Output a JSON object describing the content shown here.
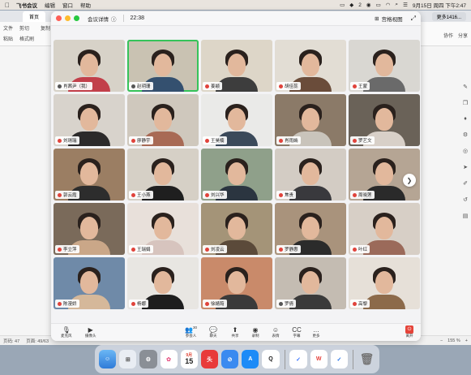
{
  "menubar": {
    "app_name": "飞书会议",
    "items": [
      "编辑",
      "窗口",
      "帮助"
    ],
    "datetime": "9月15日 周四 下午2:47",
    "badge_count": "2"
  },
  "background_window": {
    "tab_label": "首页",
    "second_tab": "更多1416...",
    "toolbar_items": [
      "文件",
      "粘贴",
      "剪切",
      "格式刷",
      "复制"
    ],
    "right_tools": [
      "协作",
      "分享"
    ],
    "status_page": "页码: 47",
    "status_pages": "页面: 49/63",
    "zoom_level": "155 %"
  },
  "meeting": {
    "title": "会议详情",
    "timer": "22:38",
    "view_label": "宫格视图",
    "participants": [
      {
        "name": "肖茜尹（我）",
        "mic": "on",
        "bg": "#d7d2c8",
        "shirt": "#c23f4a"
      },
      {
        "name": "赵玥珊",
        "mic": "on",
        "bg": "#c9c2b2",
        "shirt": "#34506f",
        "active": true
      },
      {
        "name": "姜颖",
        "mic": "off",
        "bg": "#ddd6c8",
        "shirt": "#3d3d3d"
      },
      {
        "name": "胡佳蕊",
        "mic": "off",
        "bg": "#e2ddd4",
        "shirt": "#6a4c3a"
      },
      {
        "name": "王蒙",
        "mic": "off",
        "bg": "#d9d7d2",
        "shirt": "#6a6a6a"
      },
      {
        "name": "刘琍瑞",
        "mic": "off",
        "bg": "#d8d3cc",
        "shirt": "#2c2a2a"
      },
      {
        "name": "廖静宇",
        "mic": "off",
        "bg": "#cfc8bd",
        "shirt": "#a86a55"
      },
      {
        "name": "王昊楠",
        "mic": "off",
        "bg": "#eaeae8",
        "shirt": "#3b4a5a"
      },
      {
        "name": "肖雨嫣",
        "mic": "off",
        "bg": "#8b7a68",
        "shirt": "#c9c4bb"
      },
      {
        "name": "罗艺文",
        "mic": "off",
        "bg": "#6a6258",
        "shirt": "#d8d0c8"
      },
      {
        "name": "郭云霞",
        "mic": "off",
        "bg": "#9b7e63",
        "shirt": "#2d2d2d"
      },
      {
        "name": "王小燕",
        "mic": "off",
        "bg": "#d6d0c6",
        "shirt": "#1f1f1f"
      },
      {
        "name": "刘兴华",
        "mic": "off",
        "bg": "#8fa08a",
        "shirt": "#2b3540"
      },
      {
        "name": "焦贵",
        "mic": "off",
        "bg": "#d3ccc4",
        "shirt": "#39393d"
      },
      {
        "name": "周晓莲",
        "mic": "off",
        "bg": "#b5a594",
        "shirt": "#2a2a2a"
      },
      {
        "name": "李立萍",
        "mic": "off",
        "bg": "#7a6a5a",
        "shirt": "#caa788"
      },
      {
        "name": "王瑞娟",
        "mic": "off",
        "bg": "#e8e0da",
        "shirt": "#d7c4be"
      },
      {
        "name": "刘凌云",
        "mic": "off",
        "bg": "#a49478",
        "shirt": "#5b4a3a"
      },
      {
        "name": "罗静惠",
        "mic": "off",
        "bg": "#a9937c",
        "shirt": "#2b2b2b"
      },
      {
        "name": "叶红",
        "mic": "off",
        "bg": "#d7cfc6",
        "shirt": "#9b6a5a"
      },
      {
        "name": "陈漫娇",
        "mic": "off",
        "bg": "#6f8aa8",
        "shirt": "#d5b89a"
      },
      {
        "name": "杨娜",
        "mic": "off",
        "bg": "#e8e6e2",
        "shirt": "#1e1e1e"
      },
      {
        "name": "徐婧筠",
        "mic": "off",
        "bg": "#c98a6a",
        "shirt": "#3a3a3a"
      },
      {
        "name": "罗倩",
        "mic": "on",
        "bg": "#c4bcb2",
        "shirt": "#3a3a3a"
      },
      {
        "name": "高黎",
        "mic": "off",
        "bg": "#e6e0d8",
        "shirt": "#8c6a4a"
      }
    ],
    "controls": [
      {
        "label": "麦克风",
        "icon": "mic-icon"
      },
      {
        "label": "摄像头",
        "icon": "camera-icon"
      },
      {
        "label": "参会人",
        "icon": "people-icon",
        "count": "30"
      },
      {
        "label": "聊天",
        "icon": "chat-icon"
      },
      {
        "label": "共享",
        "icon": "share-icon"
      },
      {
        "label": "录制",
        "icon": "record-icon"
      },
      {
        "label": "表情",
        "icon": "emoji-icon"
      },
      {
        "label": "字幕",
        "icon": "subtitle-icon"
      },
      {
        "label": "更多",
        "icon": "more-icon"
      },
      {
        "label": "离开",
        "icon": "leave-icon"
      }
    ]
  },
  "dock": {
    "calendar_month": "9月",
    "calendar_day": "15",
    "apps": [
      "finder",
      "launchpad",
      "system-preferences",
      "photos",
      "calendar",
      "toutiao",
      "safari",
      "app-store",
      "qq",
      "feishu",
      "wps",
      "lark",
      "trash"
    ]
  }
}
